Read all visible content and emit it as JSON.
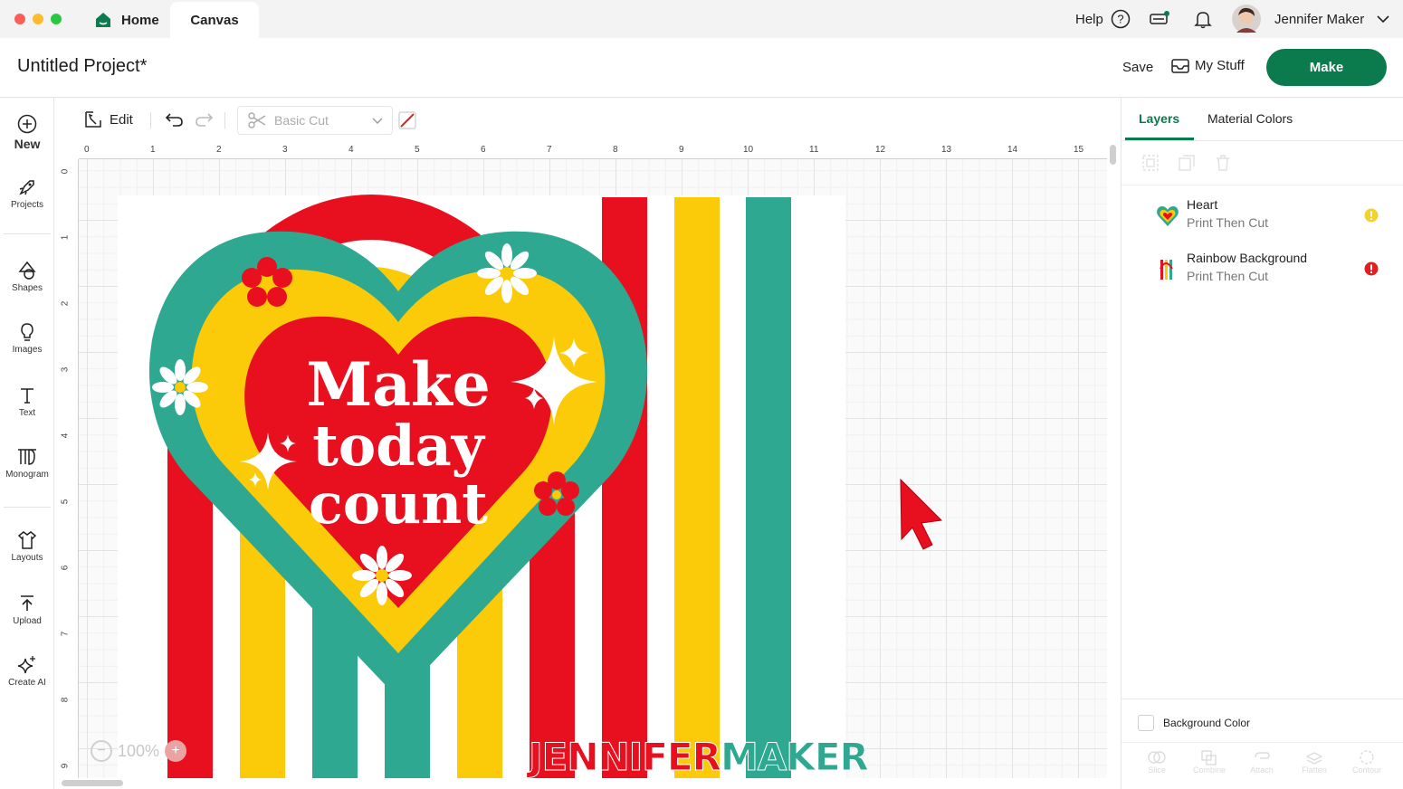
{
  "tabs": {
    "home": "Home",
    "canvas": "Canvas"
  },
  "topbar": {
    "help": "Help",
    "user_name": "Jennifer Maker"
  },
  "header": {
    "project_title": "Untitled Project*",
    "save": "Save",
    "my_stuff": "My Stuff",
    "make": "Make"
  },
  "sidebar": {
    "items": [
      {
        "label": "New",
        "icon": "plus-circle-icon"
      },
      {
        "label": "Projects",
        "icon": "projects-icon"
      },
      {
        "label": "Shapes",
        "icon": "shapes-icon"
      },
      {
        "label": "Images",
        "icon": "lightbulb-icon"
      },
      {
        "label": "Text",
        "icon": "text-icon"
      },
      {
        "label": "Monogram",
        "icon": "monogram-icon"
      },
      {
        "label": "Layouts",
        "icon": "shirt-icon"
      },
      {
        "label": "Upload",
        "icon": "upload-icon"
      },
      {
        "label": "Create AI",
        "icon": "sparkle-icon"
      }
    ]
  },
  "toolbar": {
    "edit": "Edit",
    "operation": "Basic Cut"
  },
  "ruler": {
    "top": [
      "0",
      "1",
      "2",
      "3",
      "4",
      "5",
      "6",
      "7",
      "8",
      "9",
      "10",
      "11",
      "12",
      "13",
      "14",
      "15"
    ],
    "left": [
      "0",
      "1",
      "2",
      "3",
      "4",
      "5",
      "6",
      "7",
      "8",
      "9"
    ]
  },
  "canvas": {
    "design_text": [
      "Make",
      "today",
      "count"
    ],
    "zoom": "100%",
    "watermark_part1": "JENNIFER",
    "watermark_part2": "MAKER",
    "colors": {
      "red": "#e8101e",
      "yellow": "#fbcb09",
      "teal": "#2ea890",
      "white": "#ffffff"
    }
  },
  "panel": {
    "tabs": [
      "Layers",
      "Material Colors"
    ],
    "layers": [
      {
        "name": "Heart",
        "operation": "Print Then Cut",
        "status": "warning",
        "status_color": "#f3d22e"
      },
      {
        "name": "Rainbow Background",
        "operation": "Print Then Cut",
        "status": "error",
        "status_color": "#e02020"
      }
    ],
    "background_color_label": "Background Color",
    "footer_tools": [
      "Slice",
      "Combine",
      "Attach",
      "Flatten",
      "Contour"
    ]
  },
  "brand": {
    "green": "#0b7a4d"
  }
}
